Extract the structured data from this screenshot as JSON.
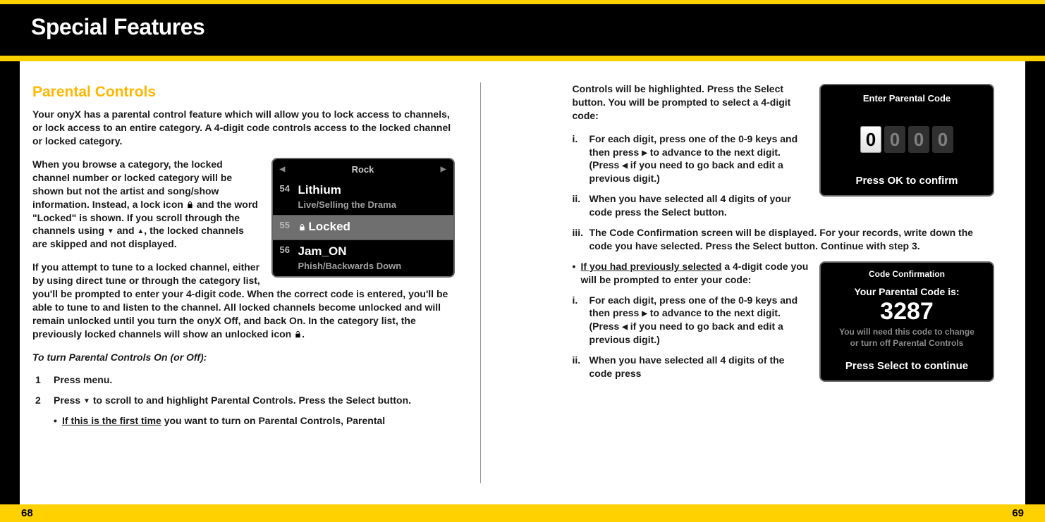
{
  "header": {
    "title": "Special Features"
  },
  "footer": {
    "left_page": "68",
    "right_page": "69"
  },
  "left": {
    "section_title": "Parental Controls",
    "intro": "Your onyX has a parental control feature which will allow you to lock access to channels, or lock access to an entire category. A 4-digit code controls access to the locked channel or locked category.",
    "browse_pre": "When you browse a category, the locked channel number or locked category will be shown but not the artist and song/show information. Instead, a lock icon ",
    "browse_mid": " and the word \"Locked\" is shown. If you scroll through the channels using ",
    "browse_post": ", the locked channels are skipped and not displayed.",
    "attempt_pre": "If you attempt to tune to a locked channel, either by using direct tune or through the category list, you'll be prompted to enter your 4-digit code. When the correct code is entered, you'll be able to tune to and listen to the channel. All locked channels become unlocked and will remain unlocked until you turn the onyX Off, and back On. In the category list, the previously locked channels will show an unlocked icon ",
    "attempt_post": ".",
    "toggle_heading": "To turn Parental Controls On (or Off):",
    "step1_pre": "Press ",
    "step1_menu": "menu",
    "step1_post": ".",
    "step2_pre": "Press ",
    "step2_mid1": " to scroll to and highlight ",
    "step2_pc": "Parental Controls",
    "step2_mid2": ". Press the ",
    "step2_sb": "Select button",
    "step2_post": ".",
    "bullet_ft_pre": "If this is the first time",
    "bullet_ft_mid": " you want to turn on Parental Controls, ",
    "bullet_ft_bold": "Parental",
    "and_word": " and ",
    "screen": {
      "category": "Rock",
      "rows": [
        {
          "num": "54",
          "name": "Lithium",
          "sub": "Live/Selling the Drama"
        },
        {
          "num": "55",
          "locked_label": "Locked"
        },
        {
          "num": "56",
          "name": "Jam_ON",
          "sub": "Phish/Backwards Down"
        }
      ]
    }
  },
  "right": {
    "cont_bold1": "Controls",
    "cont_mid": " will be highlighted. Press the ",
    "cont_bold2": "Select button",
    "cont_post": ". You will be prompted to select a 4-digit code:",
    "i_pre": "For each digit, press one of the ",
    "i_keys": "0-9",
    "i_mid1": " keys and then press ",
    "i_mid2": " to advance to the next digit. (Press ",
    "i_post": " if you need to go back and edit a previous digit.)",
    "ii_pre": "When you have selected all 4 digits of your code press the ",
    "ii_sb": "Select button",
    "ii_post": ".",
    "iii_pre": "The Code Confirmation screen will be displayed. For your records, write down the code you have selected. Press the ",
    "iii_sb": "Select button",
    "iii_post": ". Continue with step 3.",
    "prev_u": "If you had previously selected",
    "prev_rest": " a 4-digit code you will be prompted to enter your code:",
    "ri_pre": "For each digit, press one of the ",
    "ri_keys": "0-9",
    "ri_mid1": " keys and then press ",
    "ri_mid2": " to advance to the next digit. (Press ",
    "ri_post": " if you need to go back and edit a previous digit.)",
    "rii": "When you have selected all 4 digits of the code press",
    "code_screen": {
      "title": "Enter Parental Code",
      "d0": "0",
      "d1": "0",
      "d2": "0",
      "d3": "0",
      "footer": "Press OK to confirm"
    },
    "conf_screen": {
      "title": "Code Confirmation",
      "sub": "Your Parental Code is:",
      "code": "3287",
      "note1": "You will need this code to change",
      "note2": "or turn off Parental Controls",
      "footer": "Press Select to continue"
    }
  }
}
